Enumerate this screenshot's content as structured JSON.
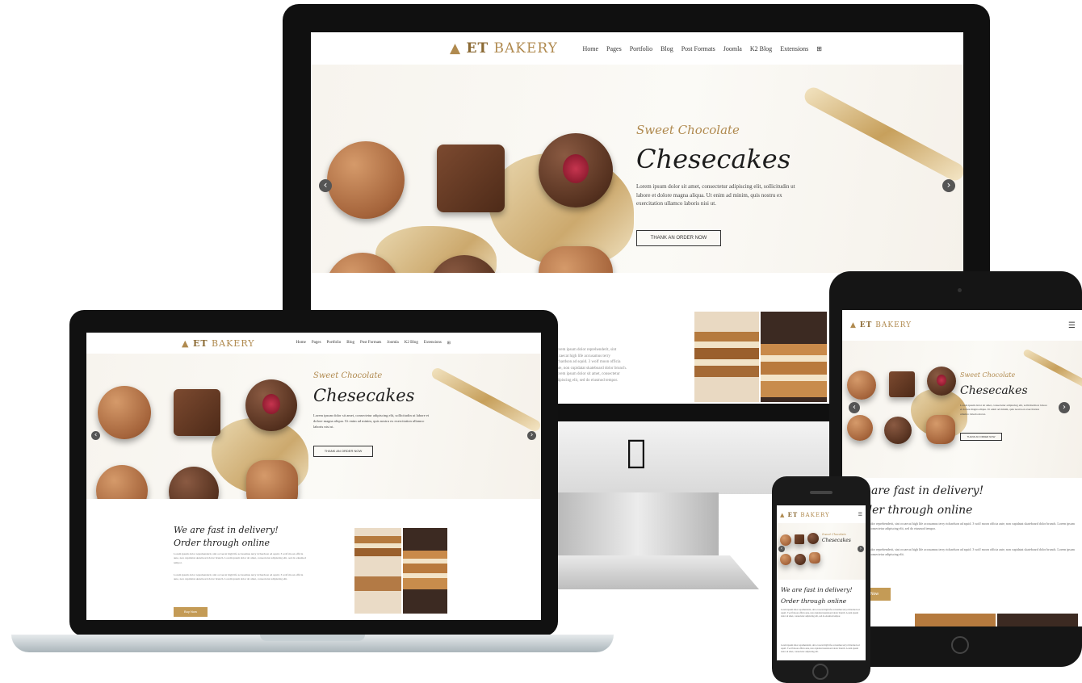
{
  "site": {
    "logo_mark": "ET",
    "logo_text": "BAKERY",
    "menu": [
      "Home",
      "Pages",
      "Portfolio",
      "Blog",
      "Post Formats",
      "Joomla",
      "K2 Blog",
      "Extensions"
    ],
    "menu_search_icon": "search-icon",
    "hamburger_icon": "☰"
  },
  "hero": {
    "subtitle": "Sweet Chocolate",
    "title": "Chesecakes",
    "text": "Lorem ipsum dolor sit amet, consectetur adipiscing elit, sollicitudin ut labore et dolore magna aliqua. Ut enim ad minim, quis nostru ex exercitation ullamco laboris nisi ut.",
    "button": "THANK AN ORDER NOW",
    "prev_icon": "‹",
    "next_icon": "›"
  },
  "section": {
    "heading1": "We are fast in delivery!",
    "heading2": "Order through online",
    "paragraph1": "Lorem ipsum dolor reprehenderit, sint occaecat high life accusamus terry richardson ad squid. 3 wolf moon officia aute, non cupidatat skateboard dolor brunch. Lorem ipsum dolor sit amet, consectetur adipiscing elit, sed do eiusmod tempor.",
    "paragraph2": "Lorem ipsum dolor reprehenderit, sint occaecat high life accusamus terry richardson ad squid. 3 wolf moon officia aute, non cupidatat skateboard dolor brunch. Lorem ipsum dolor sit amet, consectetur adipiscing elit.",
    "button": "Buy Now"
  },
  "icons": {
    "apple": "apple-logo-icon"
  },
  "colors": {
    "accent": "#c49b56",
    "logo": "#b08a4f",
    "text": "#1e1e1e",
    "device": "#111111"
  }
}
